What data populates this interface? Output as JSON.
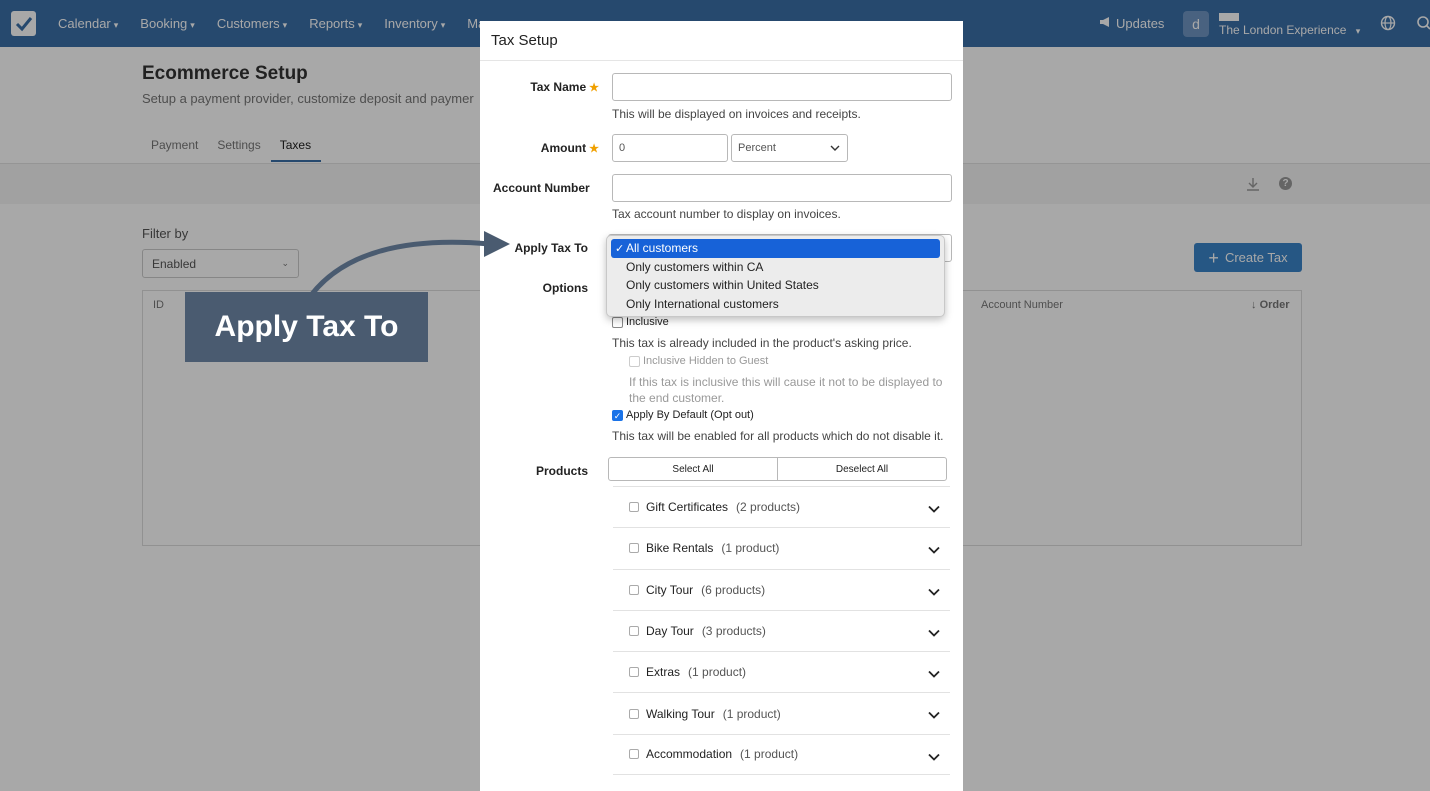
{
  "nav": {
    "items": [
      "Calendar",
      "Booking",
      "Customers",
      "Reports",
      "Inventory",
      "Ma"
    ],
    "updates": "Updates",
    "avatar": "d",
    "company": "The London Experience"
  },
  "page": {
    "title": "Ecommerce Setup",
    "subtitle": "Setup a payment provider, customize deposit and paymer",
    "tabs": [
      "Payment",
      "Settings",
      "Taxes"
    ],
    "filter_label": "Filter by",
    "filter_value": "Enabled",
    "create_button": "Create Tax",
    "table_headers": {
      "id": "ID",
      "account_number": "Account Number",
      "order": "Order"
    }
  },
  "modal": {
    "title": "Tax Setup",
    "tax_name": {
      "label": "Tax Name",
      "value": "",
      "help": "This will be displayed on invoices and receipts."
    },
    "amount": {
      "label": "Amount",
      "value": "0",
      "unit": "Percent"
    },
    "account_number": {
      "label": "Account Number",
      "value": "",
      "help": "Tax account number to display on invoices."
    },
    "apply_tax_to": {
      "label": "Apply Tax To",
      "options": [
        "All customers",
        "Only customers within CA",
        "Only customers within United States",
        "Only International customers"
      ],
      "selected_index": 0
    },
    "options": {
      "label": "Options",
      "inclusive": {
        "label": "Inclusive",
        "checked": false,
        "help": "This tax is already included in the product's asking price."
      },
      "inclusive_hidden": {
        "label": "Inclusive Hidden to Guest",
        "checked": false,
        "help_line1": "If this tax is inclusive this will cause it not to be displayed to",
        "help_line2": "the end customer."
      },
      "apply_by_default": {
        "label": "Apply By Default (Opt out)",
        "checked": true,
        "help": "This tax will be enabled for all products which do not disable it."
      }
    },
    "products": {
      "label": "Products",
      "select_all": "Select All",
      "deselect_all": "Deselect All",
      "items": [
        {
          "name": "Gift Certificates",
          "count": "(2 products)"
        },
        {
          "name": "Bike Rentals",
          "count": "(1 product)"
        },
        {
          "name": "City Tour",
          "count": "(6 products)"
        },
        {
          "name": "Day Tour",
          "count": "(3 products)"
        },
        {
          "name": "Extras",
          "count": "(1 product)"
        },
        {
          "name": "Walking Tour",
          "count": "(1 product)"
        },
        {
          "name": "Accommodation",
          "count": "(1 product)"
        }
      ]
    }
  },
  "annotation": {
    "text": "Apply Tax To"
  },
  "colors": {
    "nav": "#3a6fa8",
    "accent": "#1762d8",
    "callout": "#4a5b70",
    "star": "#f0a000"
  }
}
